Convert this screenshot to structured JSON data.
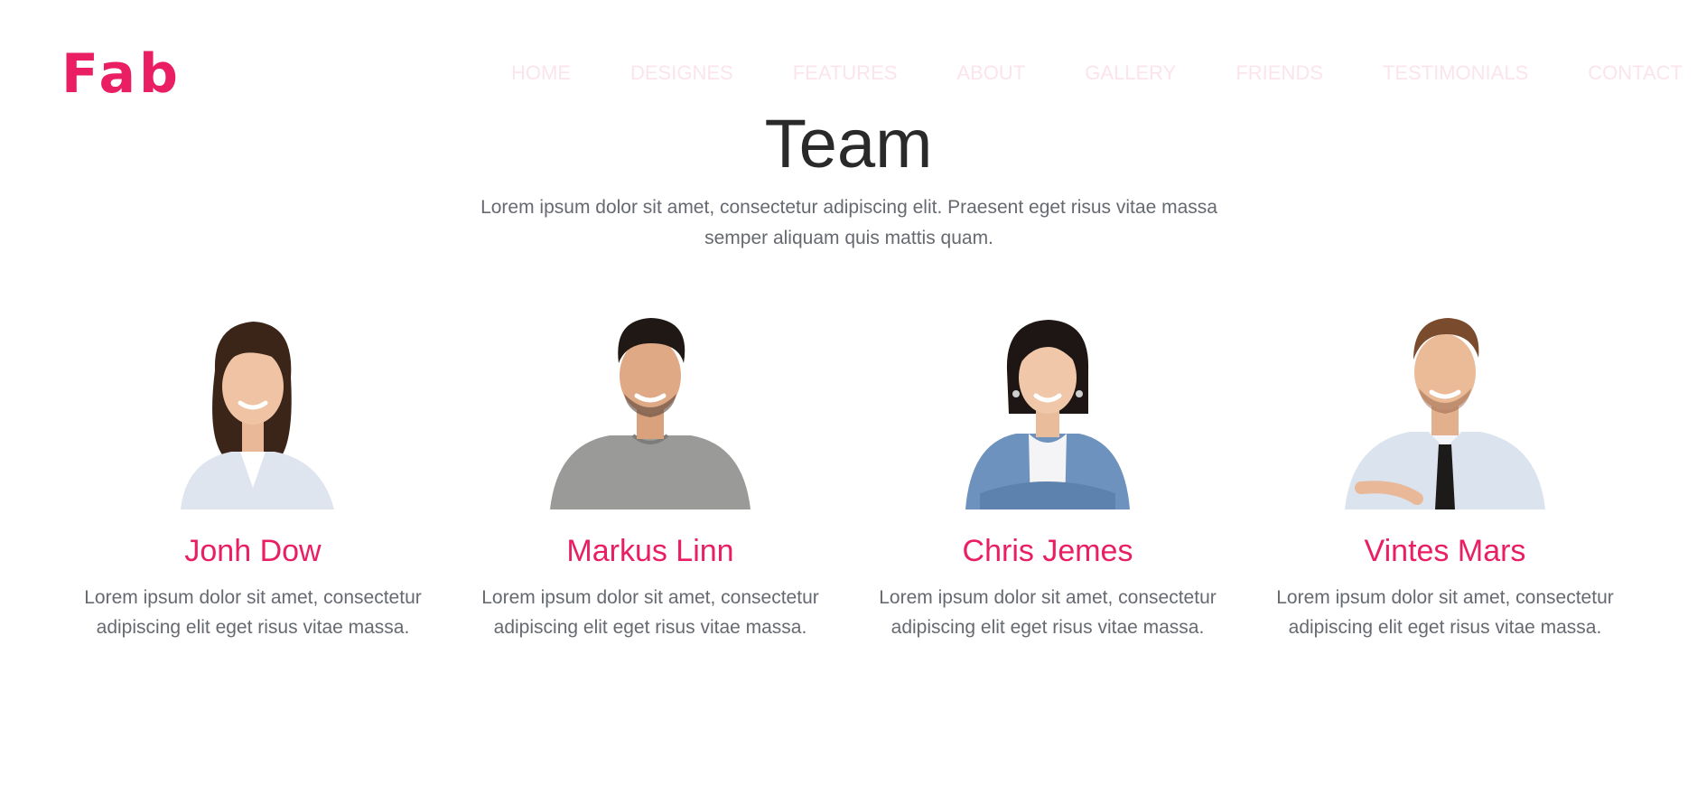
{
  "header": {
    "logo": "Fab",
    "nav": [
      "HOME",
      "DESIGNES",
      "FEATURES",
      "ABOUT",
      "GALLERY",
      "FRIENDS",
      "TESTIMONIALS",
      "CONTACT"
    ]
  },
  "section": {
    "title": "Team",
    "subtitle": "Lorem ipsum dolor sit amet, consectetur adipiscing elit. Praesent eget risus vitae massa semper aliquam quis mattis quam."
  },
  "team": [
    {
      "name": "Jonh Dow",
      "bio": "Lorem ipsum dolor sit amet, consectetur adipiscing elit eget risus vitae massa.",
      "photo_icon": "woman-portrait-icon"
    },
    {
      "name": "Markus Linn",
      "bio": "Lorem ipsum dolor sit amet, consectetur adipiscing elit eget risus vitae massa.",
      "photo_icon": "man-portrait-icon"
    },
    {
      "name": "Chris Jemes",
      "bio": "Lorem ipsum dolor sit amet, consectetur adipiscing elit eget risus vitae massa.",
      "photo_icon": "woman-portrait-icon"
    },
    {
      "name": "Vintes Mars",
      "bio": "Lorem ipsum dolor sit amet, consectetur adipiscing elit eget risus vitae massa.",
      "photo_icon": "man-portrait-icon"
    }
  ],
  "colors": {
    "accent": "#e91e63",
    "nav_text": "#fbe4ec",
    "heading": "#2a2a2a",
    "body_text": "#666a70"
  }
}
